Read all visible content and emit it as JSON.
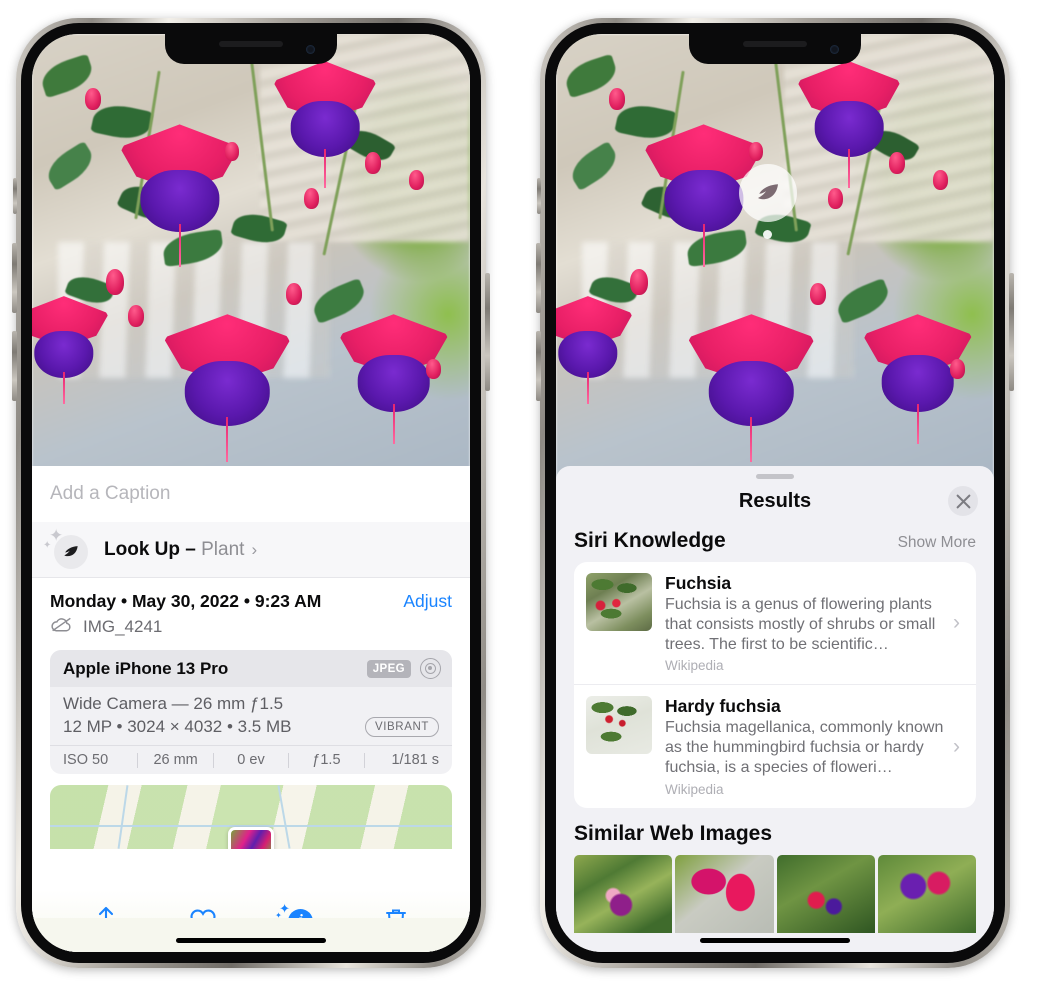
{
  "left_phone": {
    "caption": {
      "placeholder": "Add a Caption"
    },
    "lookup": {
      "label": "Look Up –",
      "subject": "Plant",
      "chevron": "›",
      "icon": "leaf-icon"
    },
    "meta": {
      "date": "Monday • May 30, 2022 • 9:23 AM",
      "adjust": "Adjust",
      "filename": "IMG_4241",
      "cloud_icon": "cloud-slash-icon"
    },
    "exif": {
      "device": "Apple iPhone 13 Pro",
      "format_badge": "JPEG",
      "hdr_icon": "lens-icon",
      "lens_line": "Wide Camera — 26 mm ƒ1.5",
      "size_line": "12 MP • 3024 × 4032 • 3.5 MB",
      "color_badge": "VIBRANT",
      "stats": [
        "ISO 50",
        "26 mm",
        "0 ev",
        "ƒ1.5",
        "1/181 s"
      ]
    },
    "toolbar": [
      {
        "name": "share-button",
        "icon": "share-icon"
      },
      {
        "name": "favorite-button",
        "icon": "heart-icon"
      },
      {
        "name": "info-button",
        "icon": "info-sparkle-icon"
      },
      {
        "name": "delete-button",
        "icon": "trash-icon"
      }
    ]
  },
  "right_phone": {
    "badge": {
      "icon": "leaf-icon"
    },
    "sheet": {
      "title": "Results",
      "close_icon": "close-icon"
    },
    "siri_knowledge": {
      "title": "Siri Knowledge",
      "show_more": "Show More",
      "cards": [
        {
          "title": "Fuchsia",
          "description": "Fuchsia is a genus of flowering plants that consists mostly of shrubs or small trees. The first to be scientific…",
          "source": "Wikipedia",
          "chevron": "›"
        },
        {
          "title": "Hardy fuchsia",
          "description": "Fuchsia magellanica, commonly known as the hummingbird fuchsia or hardy fuchsia, is a species of floweri…",
          "source": "Wikipedia",
          "chevron": "›"
        }
      ]
    },
    "similar_web_images": {
      "title": "Similar Web Images",
      "thumbs": [
        "fuchsia-thumb-1",
        "fuchsia-thumb-2",
        "fuchsia-thumb-3",
        "fuchsia-thumb-4"
      ]
    }
  },
  "colors": {
    "accent": "#1a84ff",
    "sheet_bg": "#f1f1f5",
    "card_bg": "#ffffff",
    "muted_text": "#8e8e93"
  }
}
